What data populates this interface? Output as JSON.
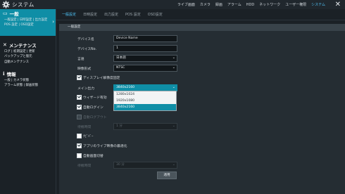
{
  "app": {
    "title": "システム",
    "logo_icon": "gear-icon",
    "close_icon": "close-icon"
  },
  "topnav": [
    "ライブ画面",
    "カメラ",
    "録画",
    "アラーム",
    "HDD",
    "ネットワーク",
    "ユーザー権限",
    "システム"
  ],
  "topnav_active": "システム",
  "sidebar": {
    "sections": [
      {
        "title": "一般",
        "icon": "monitor-icon",
        "active": true,
        "items": [
          "一般設定 | 日時設定 | 出力設定",
          "POS 設定 | OSD設定"
        ]
      },
      {
        "title": "メンテナンス",
        "icon": "wrench-icon",
        "active": false,
        "items": [
          "ログ | 初期設定 | 更新",
          "バックアップと復元",
          "自動メンテナンス"
        ]
      },
      {
        "title": "情報",
        "icon": "info-icon",
        "active": false,
        "items": [
          "一般 | カメラ状態",
          "アラーム状態 | 録画状態"
        ]
      }
    ]
  },
  "tabs": [
    "一般設定",
    "日時設定",
    "出力設定",
    "POS 設定",
    "OSD設定"
  ],
  "tabs_active": "一般設定",
  "panel": {
    "section_header": "一般設定",
    "device_name_label": "デバイス名",
    "device_name_value": "Device Name",
    "device_no_label": "デバイスNo.",
    "device_no_value": "1",
    "language_label": "言語",
    "language_value": "日本語",
    "video_format_label": "映像形式",
    "video_format_value": "NTSC",
    "display_res_check": "ディスプレイ解像度固定",
    "main_output_label": "メイン出力",
    "main_output_value": "3840x2160",
    "wizard_check": "ウィザード有効",
    "auto_login_check": "自動ログイン",
    "auto_logout_check": "自動ログアウト",
    "wait_time_label": "待機時間",
    "wait_time_value": "1 分",
    "navbar_check": "ﾅﾋﾞﾊﾞｰ",
    "live_opt_check": "アプリのライブ映像の最適化",
    "auto_switch_check": "自動画面切替",
    "wait_time2_label": "待機時間",
    "wait_time2_value": "30 分",
    "apply_button": "適用"
  },
  "resolution_options": [
    "1280x1024",
    "1920x1080",
    "3840x2160"
  ],
  "resolution_selected": "3840x2160",
  "colors": {
    "accent": "#0f8ea6",
    "active_text": "#4fc3f7",
    "background": "#1b2126",
    "panel": "#252d33"
  }
}
